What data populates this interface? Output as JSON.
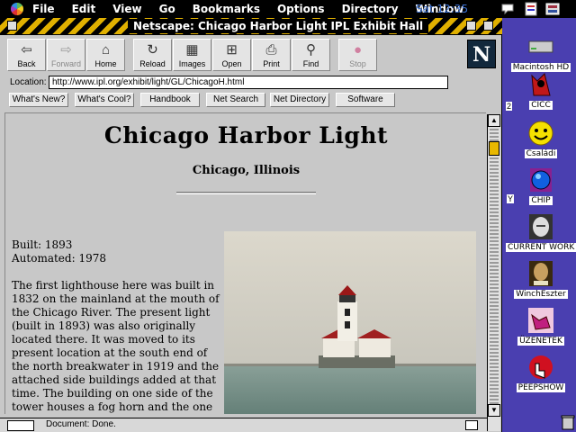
{
  "menubar": {
    "items": [
      "File",
      "Edit",
      "View",
      "Go",
      "Bookmarks",
      "Options",
      "Directory",
      "Window"
    ],
    "clock": "Sat 12:35"
  },
  "window": {
    "title": "Netscape: Chicago Harbor Light IPL Exhibit Hall"
  },
  "toolbar": {
    "back": "Back",
    "forward": "Forward",
    "home": "Home",
    "reload": "Reload",
    "images": "Images",
    "open": "Open",
    "print": "Print",
    "find": "Find",
    "stop": "Stop",
    "logo": "N"
  },
  "location": {
    "label": "Location:",
    "url": "http://www.ipl.org/exhibit/light/GL/ChicagoH.html"
  },
  "directory_buttons": [
    "What's New?",
    "What's Cool?",
    "Handbook",
    "Net Search",
    "Net Directory",
    "Software"
  ],
  "page": {
    "title": "Chicago Harbor Light",
    "subtitle": "Chicago, Illinois",
    "built": "Built: 1893",
    "automated": "Automated: 1978",
    "paragraph": "The first lighthouse here was built in 1832 on the mainland at the mouth of the Chicago River. The present light (built in 1893) was also originally located there. It was moved to its present location at the south end of the north breakwater in 1919 and the attached side buildings added at that time. The building on one side of the tower houses a fog horn and the one on the other side is a boathouse."
  },
  "status": {
    "text": "Document: Done."
  },
  "desktop": {
    "icons": [
      {
        "label": "Macintosh HD",
        "icon": "hard-disk-icon"
      },
      {
        "label": "CICC",
        "icon": "devil-folder-icon"
      },
      {
        "label": "Családi",
        "icon": "smiley-icon"
      },
      {
        "label": "CHIP",
        "icon": "globe-icon"
      },
      {
        "label": "CURRENT WORK",
        "icon": "einstein-icon"
      },
      {
        "label": "WinchEszter",
        "icon": "shakespeare-icon"
      },
      {
        "label": "ÜZENETEK",
        "icon": "hand-icon"
      },
      {
        "label": "PEEPSHOW",
        "icon": "peepshow-icon"
      }
    ],
    "marks": [
      "2",
      "Y"
    ]
  }
}
